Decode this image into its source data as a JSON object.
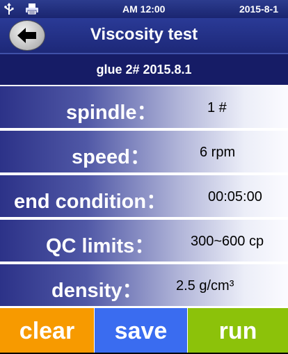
{
  "status_bar": {
    "time": "AM 12:00",
    "date": "2015-8-1",
    "icons": [
      "usb-icon",
      "printer-icon"
    ]
  },
  "header": {
    "title": "Viscosity test",
    "back_icon": "arrow-left-icon"
  },
  "subtitle": "glue 2# 2015.8.1",
  "params": [
    {
      "label": "spindle：",
      "value": "1   #"
    },
    {
      "label": "speed：",
      "value": "6   rpm"
    },
    {
      "label": "end condition：",
      "value": "00:05:00"
    },
    {
      "label": "QC limits：",
      "value": "300~600 cp"
    },
    {
      "label": "density：",
      "value": "2.5   g/cm³"
    }
  ],
  "buttons": {
    "clear": "clear",
    "save": "save",
    "run": "run"
  },
  "colors": {
    "status_bar": "#1f2b7a",
    "title_bar": "#2a3a96",
    "subtitle_bar": "#161c66",
    "clear": "#f79a00",
    "save": "#3a6cf0",
    "run": "#8cc20a"
  }
}
